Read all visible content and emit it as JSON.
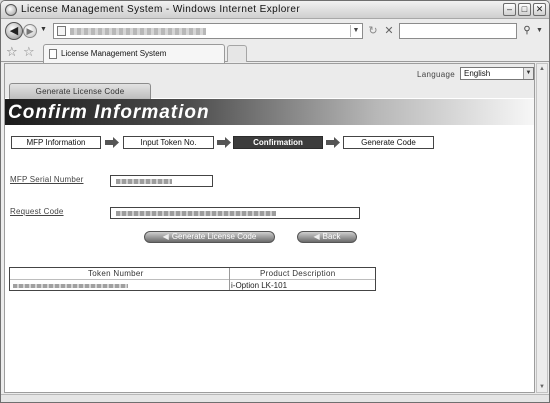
{
  "browser": {
    "title": "License Management System - Windows Internet Explorer",
    "tab_label": "License Management System"
  },
  "page": {
    "language_label": "Language",
    "language_value": "English",
    "menu_tab": "Generate License Code",
    "banner_title": "Confirm Information",
    "steps": [
      "MFP Information",
      "Input Token No.",
      "Confirmation",
      "Generate Code"
    ],
    "active_step": "Confirmation",
    "fields": {
      "serial_label": "MFP Serial Number",
      "request_label": "Request Code"
    },
    "buttons": {
      "generate": "Generate License Code",
      "back": "Back"
    },
    "table": {
      "headers": [
        "Token Number",
        "Product Description"
      ],
      "rows": [
        {
          "product": "i-Option LK-101"
        }
      ]
    }
  }
}
